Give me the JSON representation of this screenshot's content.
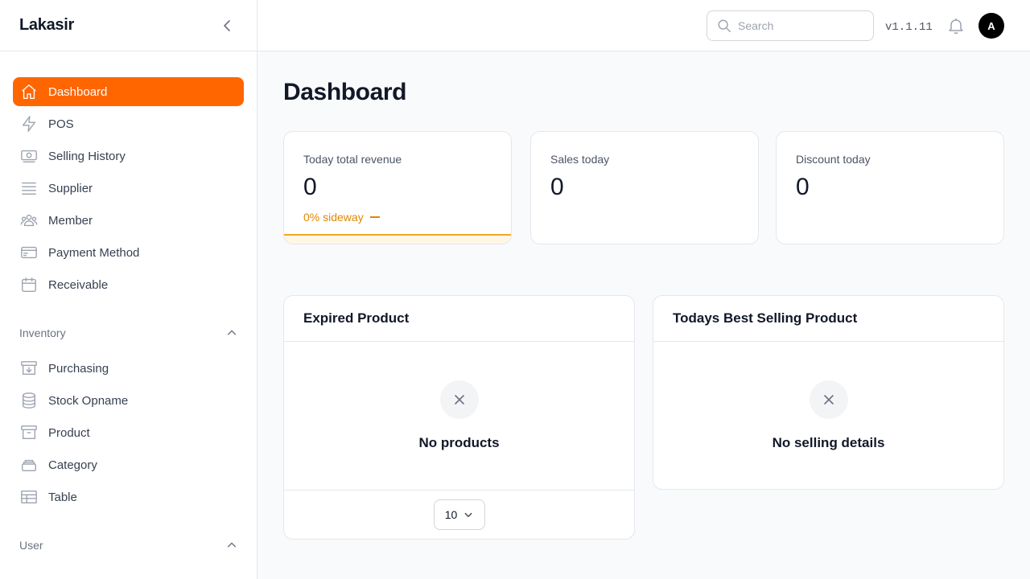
{
  "app": {
    "brand": "Lakasir",
    "version": "v1.1.11"
  },
  "topbar": {
    "search_placeholder": "Search",
    "avatar_initial": "A"
  },
  "sidebar": {
    "items": [
      {
        "label": "Dashboard",
        "icon": "home-icon",
        "active": true
      },
      {
        "label": "POS",
        "icon": "bolt-icon"
      },
      {
        "label": "Selling History",
        "icon": "banknote-icon"
      },
      {
        "label": "Supplier",
        "icon": "list-icon"
      },
      {
        "label": "Member",
        "icon": "users-icon"
      },
      {
        "label": "Payment Method",
        "icon": "credit-card-icon"
      },
      {
        "label": "Receivable",
        "icon": "calendar-icon"
      }
    ],
    "groups": [
      {
        "label": "Inventory",
        "items": [
          {
            "label": "Purchasing",
            "icon": "archive-download-icon"
          },
          {
            "label": "Stock Opname",
            "icon": "database-icon"
          },
          {
            "label": "Product",
            "icon": "archive-box-icon"
          },
          {
            "label": "Category",
            "icon": "stack-icon"
          },
          {
            "label": "Table",
            "icon": "table-icon"
          }
        ]
      },
      {
        "label": "User",
        "items": []
      }
    ]
  },
  "page": {
    "title": "Dashboard"
  },
  "stats": [
    {
      "label": "Today total revenue",
      "value": "0",
      "trend": "0% sideway"
    },
    {
      "label": "Sales today",
      "value": "0"
    },
    {
      "label": "Discount today",
      "value": "0"
    }
  ],
  "panels": {
    "expired": {
      "title": "Expired Product",
      "empty_text": "No products",
      "per_page": "10"
    },
    "best_selling": {
      "title": "Todays Best Selling Product",
      "empty_text": "No selling details"
    }
  },
  "colors": {
    "accent": "#ff6600",
    "trend": "#e08800"
  }
}
